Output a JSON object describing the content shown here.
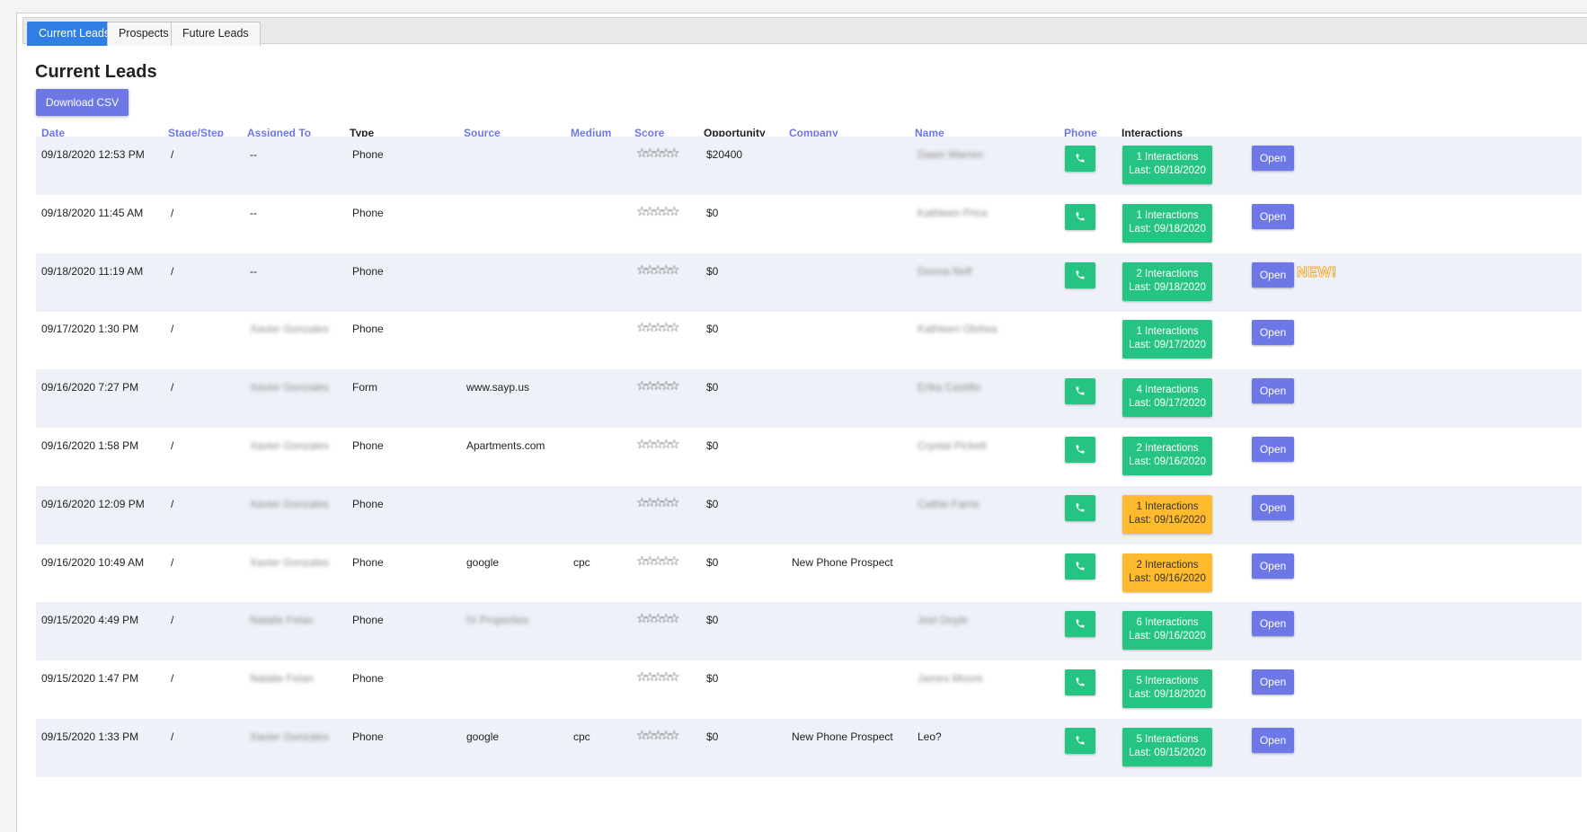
{
  "tabs": [
    {
      "label": "Current Leads",
      "active": true
    },
    {
      "label": "Prospects",
      "active": false
    },
    {
      "label": "Future Leads",
      "active": false
    }
  ],
  "page_title": "Current Leads",
  "download_label": "Download CSV",
  "columns": {
    "date": "Date",
    "stage": "Stage/Step",
    "assigned": "Assigned To",
    "type": "Type",
    "source": "Source",
    "medium": "Medium",
    "score": "Score",
    "opportunity": "Opportunity",
    "company": "Company",
    "name": "Name",
    "phone": "Phone",
    "interactions": "Interactions"
  },
  "open_label": "Open",
  "new_badge": "NEW!",
  "star_glyph": "☆",
  "colors": {
    "accent": "#6d77e6",
    "tab_active": "#2f7fe6",
    "interaction_green": "#25c483",
    "interaction_orange": "#ffbb2d",
    "row_alt": "#eef1f8"
  },
  "rows": [
    {
      "date": "09/18/2020 12:53 PM",
      "stage": "/",
      "assigned": "--",
      "type": "Phone",
      "source": "",
      "medium": "",
      "opportunity": "$20400",
      "company": "",
      "name": "Dawn Warren",
      "has_phone": true,
      "interactions": "1 Interactions",
      "last": "Last: 09/18/2020",
      "status": "green",
      "is_new": false
    },
    {
      "date": "09/18/2020 11:45 AM",
      "stage": "/",
      "assigned": "--",
      "type": "Phone",
      "source": "",
      "medium": "",
      "opportunity": "$0",
      "company": "",
      "name": "Kathleen Price",
      "has_phone": true,
      "interactions": "1 Interactions",
      "last": "Last: 09/18/2020",
      "status": "green",
      "is_new": false
    },
    {
      "date": "09/18/2020 11:19 AM",
      "stage": "/",
      "assigned": "--",
      "type": "Phone",
      "source": "",
      "medium": "",
      "opportunity": "$0",
      "company": "",
      "name": "Donna Neff",
      "has_phone": true,
      "interactions": "2 Interactions",
      "last": "Last: 09/18/2020",
      "status": "green",
      "is_new": true
    },
    {
      "date": "09/17/2020 1:30 PM",
      "stage": "/",
      "assigned": "Xavier Gonzales",
      "type": "Phone",
      "source": "",
      "medium": "",
      "opportunity": "$0",
      "company": "",
      "name": "Kathleen Olshea",
      "has_phone": false,
      "interactions": "1 Interactions",
      "last": "Last: 09/17/2020",
      "status": "green",
      "is_new": false
    },
    {
      "date": "09/16/2020 7:27 PM",
      "stage": "/",
      "assigned": "Xavier Gonzales",
      "type": "Form",
      "source": "www.sayp.us",
      "medium": "",
      "opportunity": "$0",
      "company": "",
      "name": "Erika Castillo",
      "has_phone": true,
      "interactions": "4 Interactions",
      "last": "Last: 09/17/2020",
      "status": "green",
      "is_new": false
    },
    {
      "date": "09/16/2020 1:58 PM",
      "stage": "/",
      "assigned": "Xavier Gonzales",
      "type": "Phone",
      "source": "Apartments.com",
      "medium": "",
      "opportunity": "$0",
      "company": "",
      "name": "Crystal Pickett",
      "has_phone": true,
      "interactions": "2 Interactions",
      "last": "Last: 09/16/2020",
      "status": "green",
      "is_new": false
    },
    {
      "date": "09/16/2020 12:09 PM",
      "stage": "/",
      "assigned": "Xavier Gonzales",
      "type": "Phone",
      "source": "",
      "medium": "",
      "opportunity": "$0",
      "company": "",
      "name": "Cathie Farris",
      "has_phone": true,
      "interactions": "1 Interactions",
      "last": "Last: 09/16/2020",
      "status": "orange",
      "is_new": false
    },
    {
      "date": "09/16/2020 10:49 AM",
      "stage": "/",
      "assigned": "Xavier Gonzales",
      "type": "Phone",
      "source": "google",
      "medium": "cpc",
      "opportunity": "$0",
      "company": "New Phone Prospect",
      "name": "",
      "has_phone": true,
      "interactions": "2 Interactions",
      "last": "Last: 09/16/2020",
      "status": "orange",
      "is_new": false
    },
    {
      "date": "09/15/2020 4:49 PM",
      "stage": "/",
      "assigned": "Natalie Felan",
      "type": "Phone",
      "source": "IV Properties",
      "medium": "",
      "opportunity": "$0",
      "company": "",
      "name": "Joel Doyle",
      "has_phone": true,
      "interactions": "6 Interactions",
      "last": "Last: 09/16/2020",
      "status": "green",
      "is_new": false
    },
    {
      "date": "09/15/2020 1:47 PM",
      "stage": "/",
      "assigned": "Natalie Felan",
      "type": "Phone",
      "source": "",
      "medium": "",
      "opportunity": "$0",
      "company": "",
      "name": "James Moore",
      "has_phone": true,
      "interactions": "5 Interactions",
      "last": "Last: 09/18/2020",
      "status": "green",
      "is_new": false
    },
    {
      "date": "09/15/2020 1:33 PM",
      "stage": "/",
      "assigned": "Xavier Gonzales",
      "type": "Phone",
      "source": "google",
      "medium": "cpc",
      "opportunity": "$0",
      "company": "New Phone Prospect",
      "name": "Leo?",
      "has_phone": true,
      "interactions": "5 Interactions",
      "last": "Last: 09/15/2020",
      "status": "green",
      "is_new": false
    }
  ]
}
